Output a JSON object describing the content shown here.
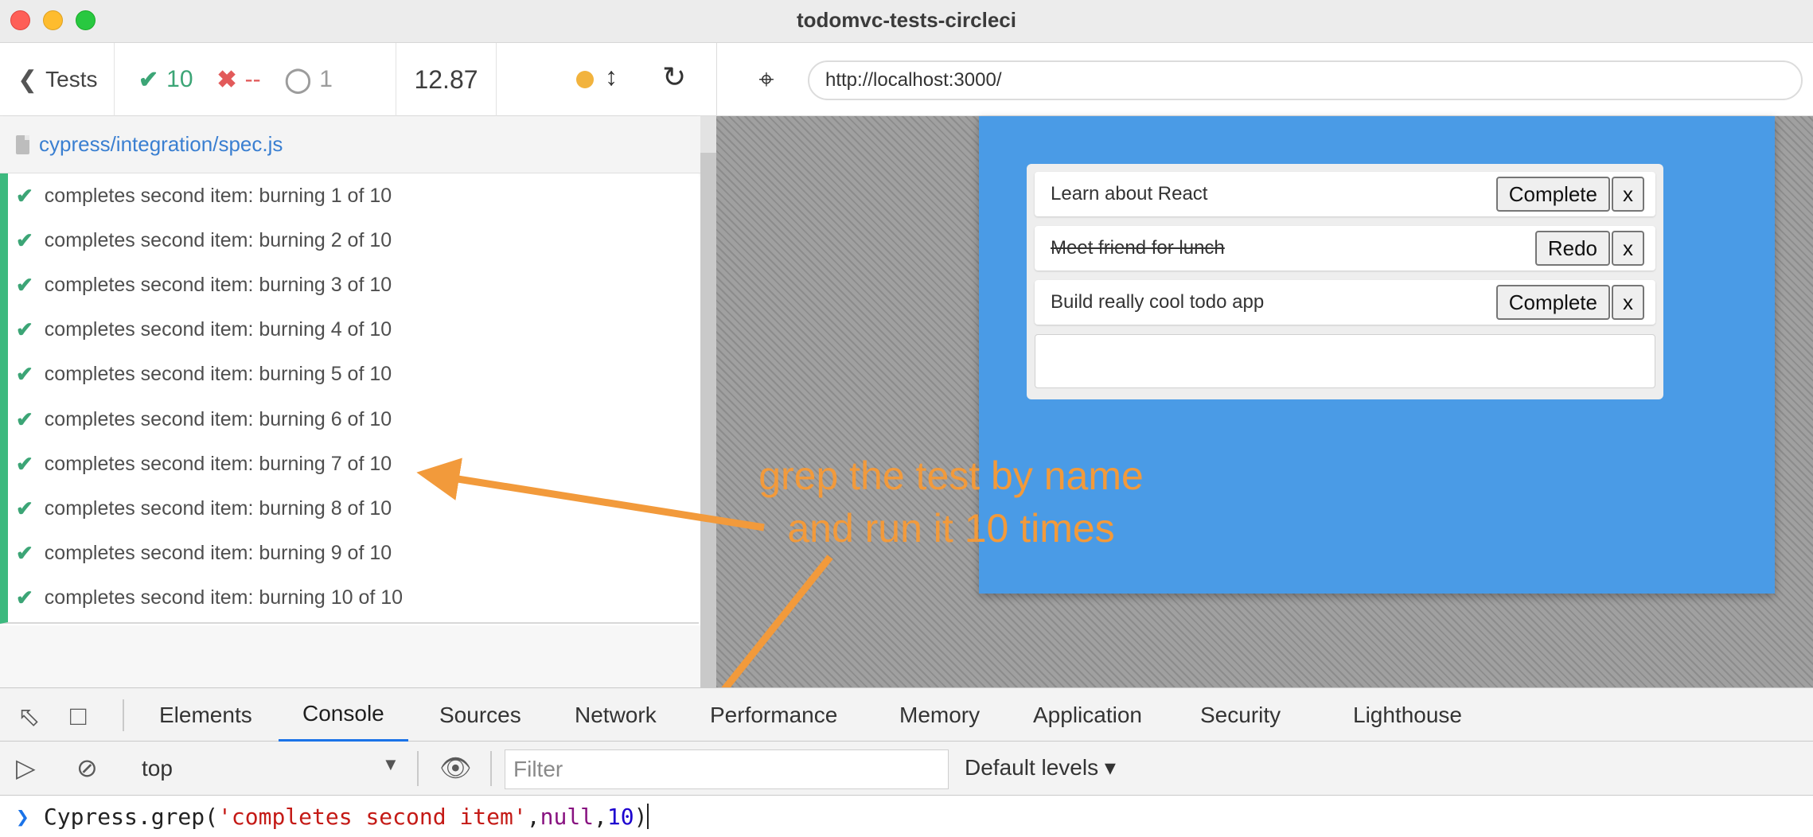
{
  "window": {
    "title": "todomvc-tests-circleci"
  },
  "runner": {
    "tests_label": "Tests",
    "passed": "10",
    "failed": "--",
    "pending": "1",
    "duration": "12.87",
    "spec_path": "cypress/integration/spec.js",
    "status_color": "#f2b33d"
  },
  "tests": [
    {
      "title": "completes second item: burning 1 of 10",
      "state": "passed"
    },
    {
      "title": "completes second item: burning 2 of 10",
      "state": "passed"
    },
    {
      "title": "completes second item: burning 3 of 10",
      "state": "passed"
    },
    {
      "title": "completes second item: burning 4 of 10",
      "state": "passed"
    },
    {
      "title": "completes second item: burning 5 of 10",
      "state": "passed"
    },
    {
      "title": "completes second item: burning 6 of 10",
      "state": "passed"
    },
    {
      "title": "completes second item: burning 7 of 10",
      "state": "passed"
    },
    {
      "title": "completes second item: burning 8 of 10",
      "state": "passed"
    },
    {
      "title": "completes second item: burning 9 of 10",
      "state": "passed"
    },
    {
      "title": "completes second item: burning 10 of 10",
      "state": "passed"
    }
  ],
  "aut": {
    "url": "http://localhost:3000/",
    "todos": [
      {
        "text": "Learn about React",
        "action": "Complete",
        "remove": "x",
        "done": false
      },
      {
        "text": "Meet friend for lunch",
        "action": "Redo",
        "remove": "x",
        "done": true
      },
      {
        "text": "Build really cool todo app",
        "action": "Complete",
        "remove": "x",
        "done": false
      }
    ]
  },
  "annotation": {
    "line1": "grep the test by name",
    "line2": "and run it 10 times",
    "color": "#f29a3b"
  },
  "devtools": {
    "tabs": [
      "Elements",
      "Console",
      "Sources",
      "Network",
      "Performance",
      "Memory",
      "Application",
      "Security",
      "Lighthouse"
    ],
    "active_tab": "Console",
    "context": "top",
    "filter_placeholder": "Filter",
    "levels": "Default levels",
    "console_input": {
      "prefix": "Cypress.grep(",
      "arg1": "'completes second item'",
      "sep1": ", ",
      "arg2": "null",
      "sep2": ", ",
      "arg3": "10",
      "suffix": ")"
    }
  },
  "icons": {
    "back": "chevron-left-icon",
    "pass": "check-icon",
    "fail": "x-icon",
    "pending": "circle-notch-icon",
    "reload": "reload-icon",
    "selector": "crosshair-icon",
    "file": "file-icon"
  },
  "colors": {
    "pass": "#3ca576",
    "fail": "#e25a5a",
    "app_bg": "#4a9be6",
    "active_tab": "#1a73e8"
  }
}
